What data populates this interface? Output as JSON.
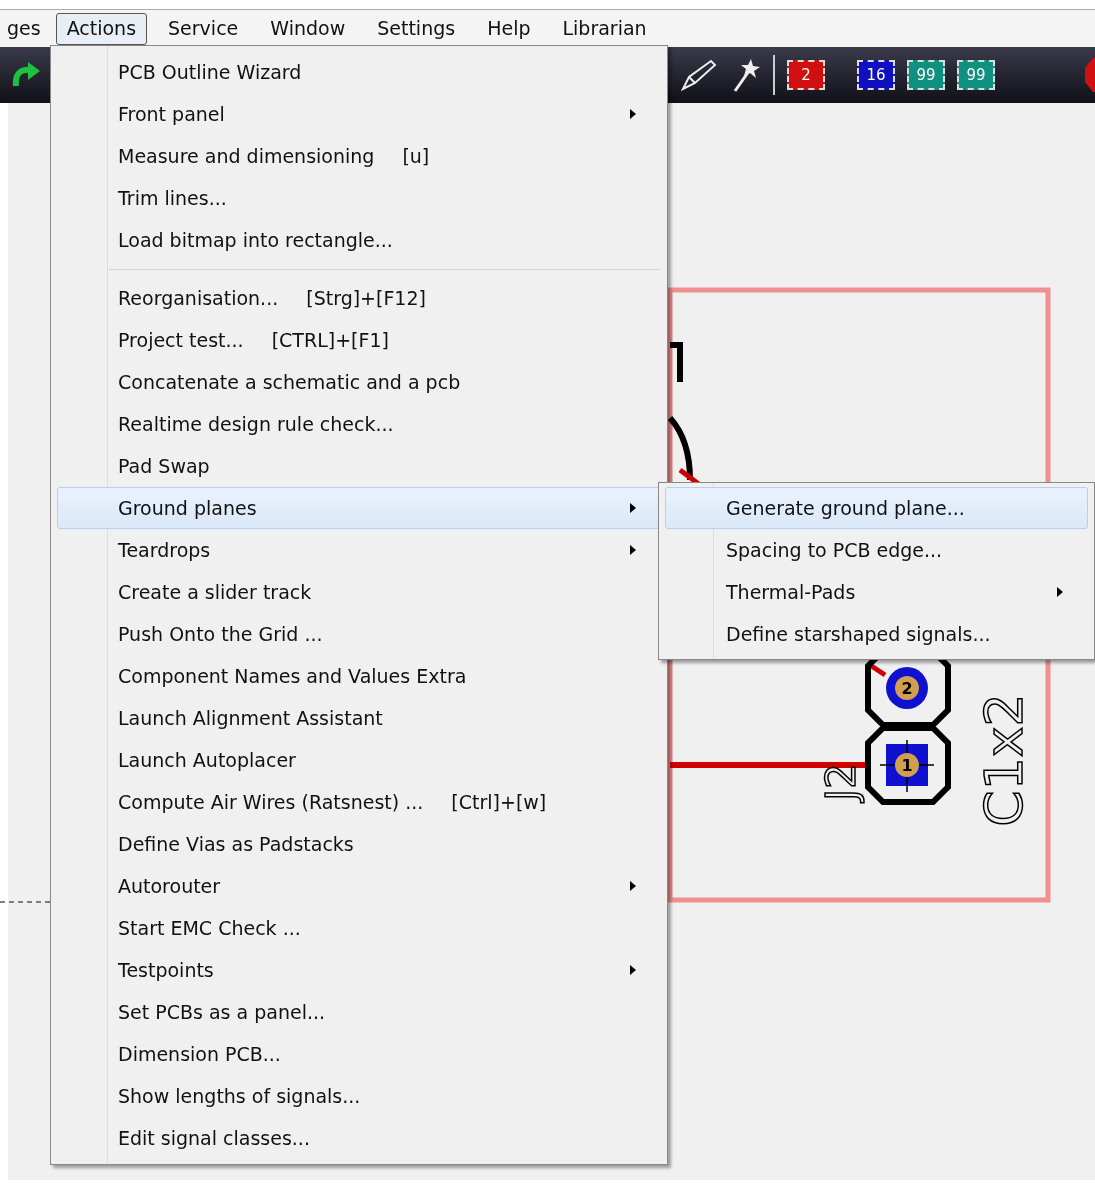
{
  "menubar": [
    {
      "label": "ges",
      "selected": false
    },
    {
      "label": "Actions",
      "selected": true
    },
    {
      "label": "Service",
      "selected": false
    },
    {
      "label": "Window",
      "selected": false
    },
    {
      "label": "Settings",
      "selected": false
    },
    {
      "label": "Help",
      "selected": false
    },
    {
      "label": "Librarian",
      "selected": false
    }
  ],
  "toolbar": {
    "badges": [
      {
        "label": "2",
        "color": "#d01010"
      },
      {
        "label": "16",
        "color": "#1010c0"
      },
      {
        "label": "99",
        "color": "#109080"
      },
      {
        "label": "99",
        "color": "#109080"
      }
    ]
  },
  "board": {
    "labels": [
      {
        "text": "J2",
        "kind": "reference"
      },
      {
        "text": "C1x2",
        "kind": "value"
      }
    ],
    "pads": [
      {
        "number": "2",
        "kind": "round"
      },
      {
        "number": "1",
        "kind": "square"
      }
    ]
  },
  "menu": [
    {
      "kind": "item",
      "label": "PCB Outline Wizard",
      "submenu": false,
      "selected": false
    },
    {
      "kind": "item",
      "label": "Front panel",
      "submenu": true,
      "selected": false
    },
    {
      "kind": "item",
      "label": "Measure and dimensioning",
      "shortcut": "[u]",
      "submenu": false,
      "selected": false
    },
    {
      "kind": "item",
      "label": "Trim lines...",
      "submenu": false,
      "selected": false
    },
    {
      "kind": "item",
      "label": "Load bitmap into rectangle...",
      "submenu": false,
      "selected": false
    },
    {
      "kind": "separator"
    },
    {
      "kind": "item",
      "label": "Reorganisation...",
      "shortcut": "[Strg]+[F12]",
      "submenu": false,
      "selected": false
    },
    {
      "kind": "item",
      "label": "Project test...",
      "shortcut": "[CTRL]+[F1]",
      "submenu": false,
      "selected": false
    },
    {
      "kind": "item",
      "label": "Concatenate a schematic and a pcb",
      "submenu": false,
      "selected": false
    },
    {
      "kind": "item",
      "label": "Realtime design rule check...",
      "submenu": false,
      "selected": false
    },
    {
      "kind": "item",
      "label": "Pad Swap",
      "submenu": false,
      "selected": false
    },
    {
      "kind": "item",
      "label": "Ground planes",
      "submenu": true,
      "selected": true
    },
    {
      "kind": "item",
      "label": "Teardrops",
      "submenu": true,
      "selected": false
    },
    {
      "kind": "item",
      "label": "Create a slider track",
      "submenu": false,
      "selected": false
    },
    {
      "kind": "item",
      "label": "Push Onto the Grid ...",
      "submenu": false,
      "selected": false
    },
    {
      "kind": "item",
      "label": "Component Names and Values Extra",
      "submenu": false,
      "selected": false
    },
    {
      "kind": "item",
      "label": "Launch Alignment Assistant",
      "submenu": false,
      "selected": false
    },
    {
      "kind": "item",
      "label": "Launch Autoplacer",
      "submenu": false,
      "selected": false
    },
    {
      "kind": "item",
      "label": "Compute Air Wires (Ratsnest) ...",
      "shortcut": "[Ctrl]+[w]",
      "submenu": false,
      "selected": false
    },
    {
      "kind": "item",
      "label": "Define Vias as Padstacks",
      "submenu": false,
      "selected": false
    },
    {
      "kind": "item",
      "label": "Autorouter",
      "submenu": true,
      "selected": false
    },
    {
      "kind": "item",
      "label": "Start EMC Check ...",
      "submenu": false,
      "selected": false
    },
    {
      "kind": "item",
      "label": "Testpoints",
      "submenu": true,
      "selected": false
    },
    {
      "kind": "item",
      "label": "Set PCBs as a panel...",
      "submenu": false,
      "selected": false
    },
    {
      "kind": "item",
      "label": "Dimension PCB...",
      "submenu": false,
      "selected": false
    },
    {
      "kind": "item",
      "label": "Show lengths of signals...",
      "submenu": false,
      "selected": false
    },
    {
      "kind": "item",
      "label": "Edit signal classes...",
      "submenu": false,
      "selected": false
    }
  ],
  "submenu": [
    {
      "label": "Generate ground plane...",
      "submenu": false,
      "selected": true
    },
    {
      "label": "Spacing to PCB edge...",
      "submenu": false,
      "selected": false
    },
    {
      "label": "Thermal-Pads",
      "submenu": true,
      "selected": false
    },
    {
      "label": "Define starshaped signals...",
      "submenu": false,
      "selected": false
    }
  ]
}
